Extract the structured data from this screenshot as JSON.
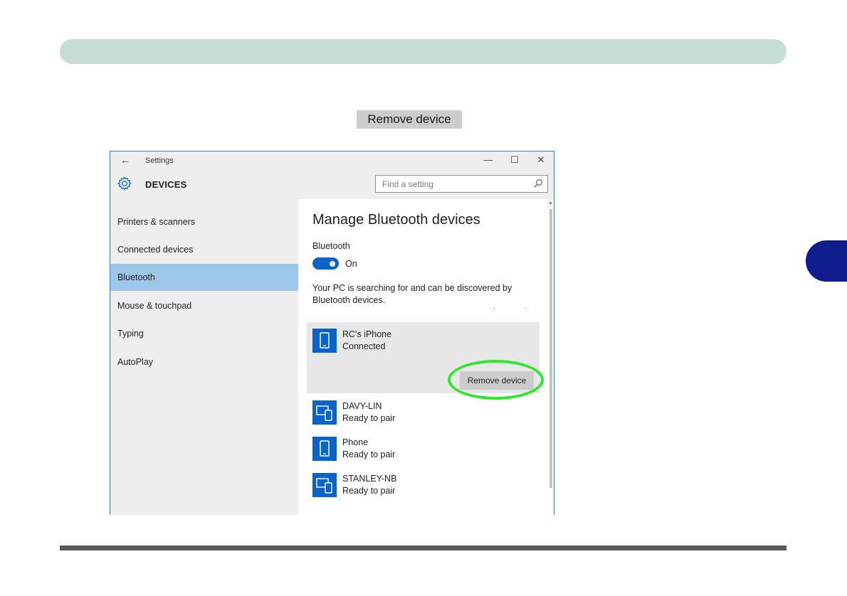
{
  "callout": {
    "label": "Remove device"
  },
  "window": {
    "title": "Settings",
    "controls": {
      "minimize": "—",
      "maximize": "☐",
      "close": "✕"
    },
    "back_icon": "←",
    "header_title": "DEVICES",
    "search_placeholder": "Find a setting"
  },
  "sidebar": {
    "items": [
      {
        "label": "Printers & scanners",
        "active": false
      },
      {
        "label": "Connected devices",
        "active": false
      },
      {
        "label": "Bluetooth",
        "active": true
      },
      {
        "label": "Mouse & touchpad",
        "active": false
      },
      {
        "label": "Typing",
        "active": false
      },
      {
        "label": "AutoPlay",
        "active": false
      }
    ]
  },
  "main": {
    "title": "Manage Bluetooth devices",
    "bluetooth_label": "Bluetooth",
    "toggle_state": "On",
    "status_text": "Your PC is searching for and can be discovered by Bluetooth devices.",
    "devices": [
      {
        "name": "RC's iPhone",
        "status": "Connected",
        "icon": "phone-icon",
        "selected": true
      },
      {
        "name": "DAVY-LIN",
        "status": "Ready to pair",
        "icon": "pc-phone-icon",
        "selected": false
      },
      {
        "name": "Phone",
        "status": "Ready to pair",
        "icon": "phone-icon",
        "selected": false
      },
      {
        "name": "STANLEY-NB",
        "status": "Ready to pair",
        "icon": "pc-phone-icon",
        "selected": false
      }
    ],
    "remove_button": "Remove device"
  },
  "colors": {
    "accent": "#0a63c9",
    "active_nav": "#9ec6e9",
    "highlight": "#2ee62e",
    "header_bar": "#c6dcd7",
    "chapter_tab": "#0f1c8c"
  }
}
